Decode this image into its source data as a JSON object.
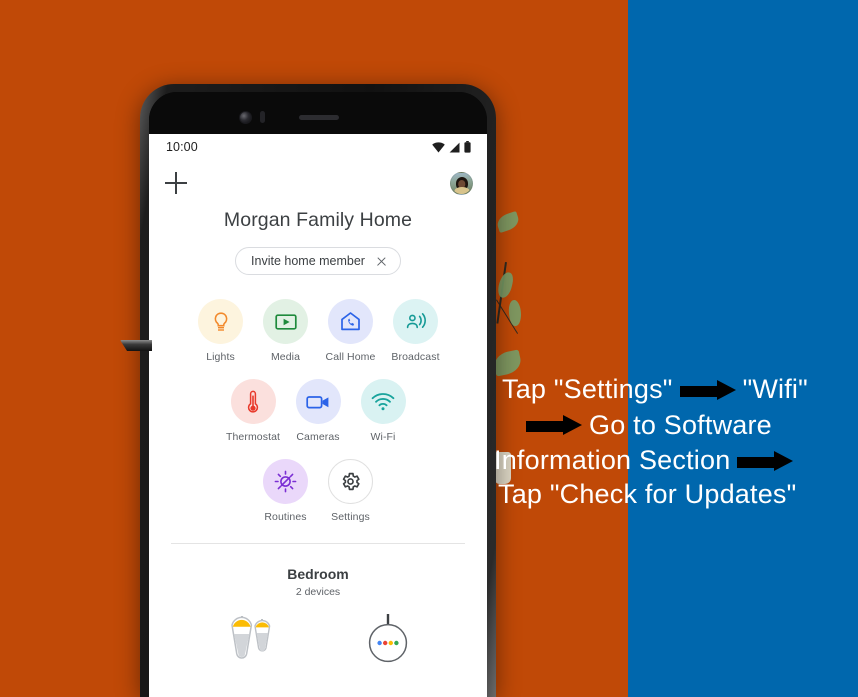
{
  "background": {
    "orange": "#c04907",
    "blue": "#0067ad"
  },
  "phone": {
    "statusbar": {
      "time": "10:00",
      "icons": [
        "wifi-icon",
        "signal-icon",
        "battery-icon"
      ]
    },
    "topbar": {
      "add_label": "+",
      "add_icon": "plus-icon",
      "avatar_icon": "user-avatar"
    },
    "home_title": "Morgan Family Home",
    "chip": {
      "label": "Invite home member",
      "dismiss_icon": "close-icon"
    },
    "shortcuts_row1": [
      {
        "label": "Lights",
        "icon": "lightbulb-icon",
        "bg": "#fdf4de",
        "fg": "#f2892b"
      },
      {
        "label": "Media",
        "icon": "play-box-icon",
        "bg": "#e2f1e4",
        "fg": "#1f8a3c"
      },
      {
        "label": "Call Home",
        "icon": "call-home-icon",
        "bg": "#e2e6fb",
        "fg": "#2b63e8"
      },
      {
        "label": "Broadcast",
        "icon": "broadcast-icon",
        "bg": "#dcf3f3",
        "fg": "#169a96"
      }
    ],
    "shortcuts_row2": [
      {
        "label": "Thermostat",
        "icon": "thermometer-icon",
        "bg": "#fbe0dd",
        "fg": "#e8392b"
      },
      {
        "label": "Cameras",
        "icon": "camera-icon",
        "bg": "#e2e6fb",
        "fg": "#2b63e8"
      },
      {
        "label": "Wi-Fi",
        "icon": "wifi-icon",
        "bg": "#d9f2f2",
        "fg": "#17a39c"
      }
    ],
    "shortcuts_row3": [
      {
        "label": "Routines",
        "icon": "routines-icon",
        "bg": "#ead8fa",
        "fg": "#7b2fd4"
      },
      {
        "label": "Settings",
        "icon": "gear-icon",
        "bg": "#ffffff",
        "fg": "#3c4043"
      }
    ],
    "room": {
      "name": "Bedroom",
      "device_count": "2 devices",
      "devices": [
        {
          "icon": "pendant-lights-icon"
        },
        {
          "icon": "smart-speaker-icon"
        }
      ]
    }
  },
  "annotation": {
    "lines": [
      {
        "text_before": "Tap \"Settings\"",
        "arrow": true,
        "text_after": "\"Wifi\""
      },
      {
        "text_before": "",
        "arrow": true,
        "text_after": "Go to  Software"
      },
      {
        "text_before": "Information Section",
        "arrow": true,
        "text_after": ""
      },
      {
        "text_before": "Tap \"Check for Updates\"",
        "arrow": false,
        "text_after": ""
      }
    ],
    "color": "#ffffff",
    "arrow_color": "#000000"
  }
}
